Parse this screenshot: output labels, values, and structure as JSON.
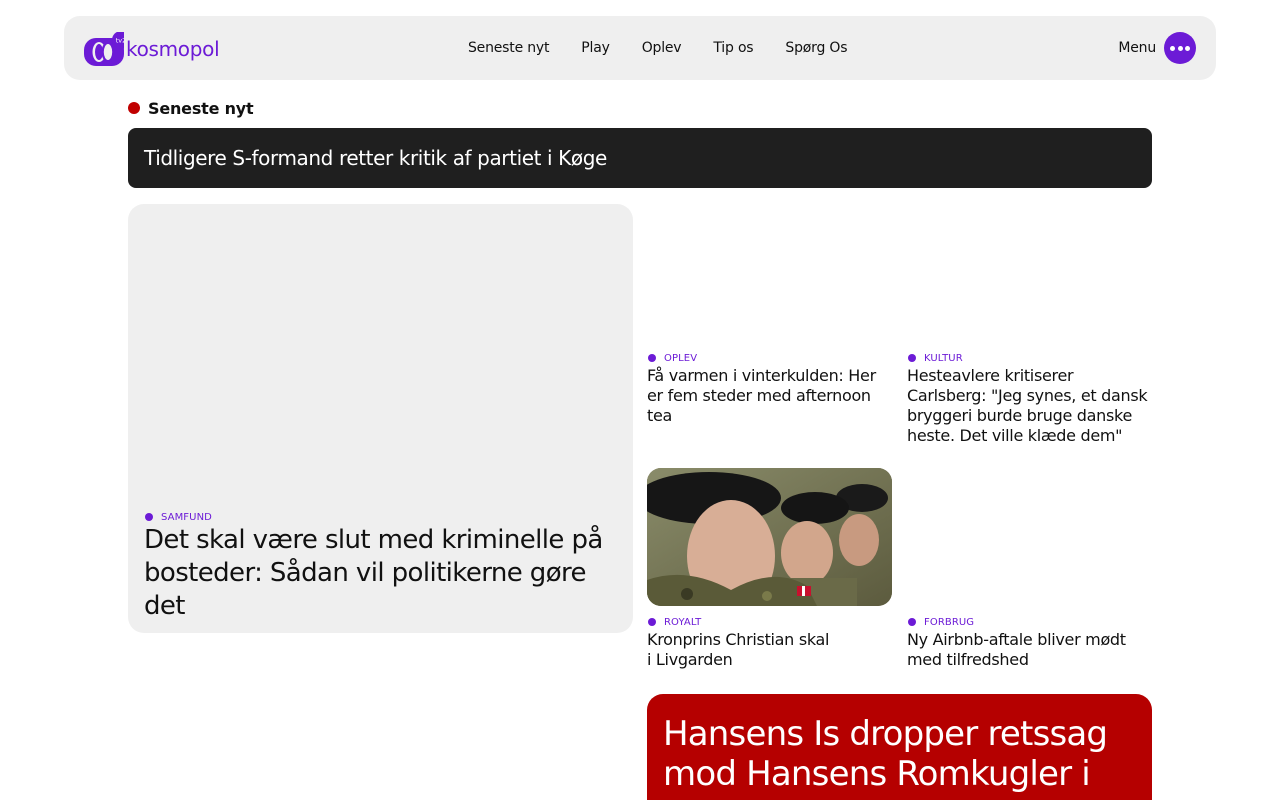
{
  "brand": {
    "name": "kosmopol",
    "badge": "tv2",
    "accent_color": "#6c1bd6"
  },
  "nav": {
    "items": [
      "Seneste nyt",
      "Play",
      "Oplev",
      "Tip os",
      "Spørg Os"
    ]
  },
  "menu": {
    "label": "Menu",
    "icon": "more-dots-icon"
  },
  "latest": {
    "title": "Seneste nyt",
    "dot_color": "#c00000"
  },
  "ticker": {
    "headline": "Tidligere S-formand retter kritik af partiet i Køge"
  },
  "featured": {
    "category": "SAMFUND",
    "headline": "Det skal være slut med kriminelle på bosteder: Sådan vil politikerne gøre det"
  },
  "articles": [
    {
      "category": "OPLEV",
      "headline": "Få varmen i vinterkulden: Her er fem steder med afternoon tea"
    },
    {
      "category": "KULTUR",
      "headline": "Hesteavlere kritiserer Carlsberg: \"Jeg synes, et dansk bryggeri burde bruge danske heste. Det ville klæde dem\""
    },
    {
      "category": "ROYALT",
      "headline": "Kronprins Christian skal i Livgarden",
      "image": "soldiers-photo"
    },
    {
      "category": "FORBRUG",
      "headline": "Ny Airbnb-aftale bliver mødt med tilfredshed"
    }
  ],
  "promo": {
    "headline": "Hansens Is dropper retssag mod Hansens Romkugler i",
    "color": "#b50000"
  }
}
